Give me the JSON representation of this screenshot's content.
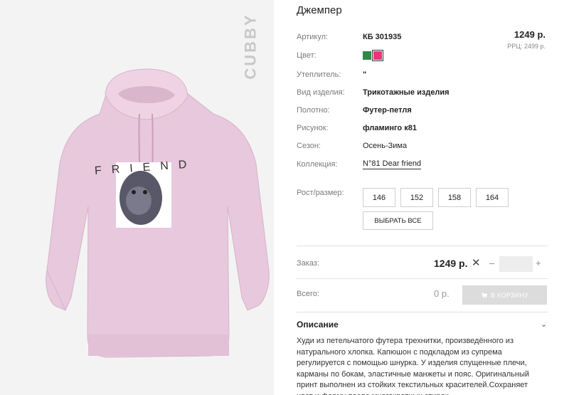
{
  "product": {
    "brand": "CUBBY",
    "title": "Джемпер",
    "graphic_text": "FRIEND"
  },
  "attributes": [
    {
      "label": "Артикул:",
      "value": "КБ 301935"
    },
    {
      "label": "Цвет:",
      "value": ""
    },
    {
      "label": "Утеплитель:",
      "value": "\""
    },
    {
      "label": "Вид изделия:",
      "value": "Трикотажные изделия"
    },
    {
      "label": "Полотно:",
      "value": "Футер-петля"
    },
    {
      "label": "Рисунок:",
      "value": "фламинго к81"
    },
    {
      "label": "Сезон:",
      "value": "Осень-Зима"
    },
    {
      "label": "Коллекция:",
      "value": "N°81 Dear friend"
    }
  ],
  "colors": [
    {
      "name": "green",
      "hex": "#2f8a4a",
      "selected": false
    },
    {
      "name": "pink",
      "hex": "#e8367a",
      "selected": true
    }
  ],
  "price": {
    "main": "1249 р.",
    "rrc": "РРЦ: 2499 р."
  },
  "sizes": {
    "label": "Рост/размер:",
    "options": [
      "146",
      "152",
      "158",
      "164"
    ],
    "select_all": "ВЫБРАТЬ ВСЕ"
  },
  "order": {
    "label": "Заказ:",
    "price": "1249 р.",
    "times": "✕",
    "minus": "–",
    "plus": "+",
    "quantity": ""
  },
  "total": {
    "label": "Всего:",
    "value": "0 р.",
    "cart_button": "В КОРЗИНУ"
  },
  "description": {
    "title": "Описание",
    "chevron": "⌄",
    "text": "Худи из петельчатого футера трехнитки, произведённого из натурального хлопка. Капюшон с подкладом из супрема регулируется с помощью шнурка. У изделия спущенные плечи, карманы по бокам, эластичные манжеты и пояс. Оригинальный принт выполнен из стойких текстильных красителей.Сохраняет цвет и форму после многократных стирок."
  },
  "icons": {
    "cart": "cart-icon",
    "close": "close-icon",
    "chevron": "chevron-down-icon"
  }
}
